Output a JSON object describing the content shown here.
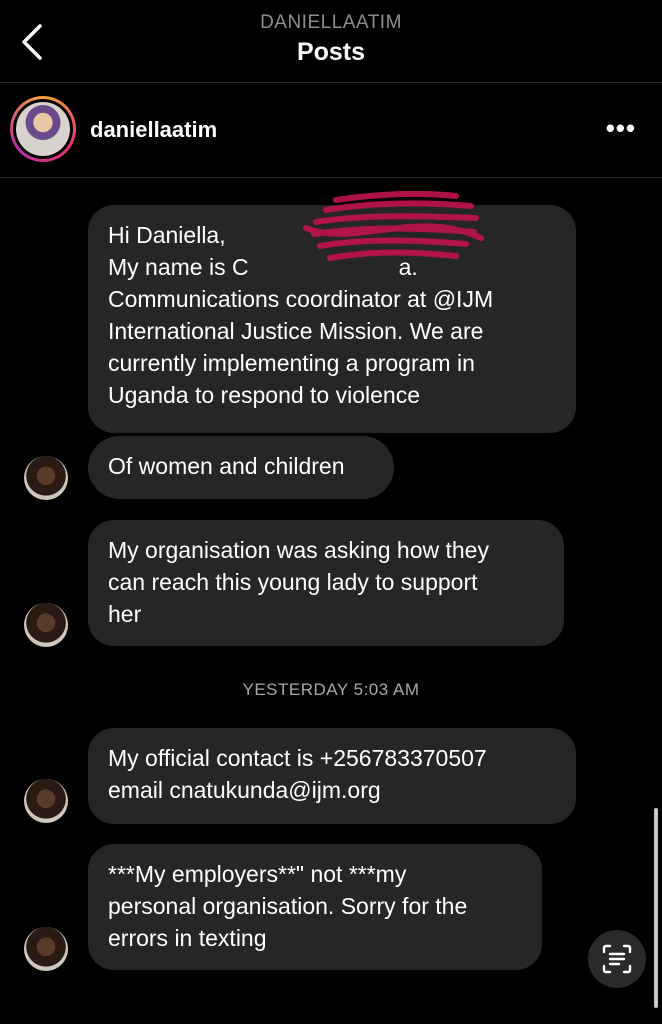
{
  "header": {
    "username": "DANIELLAATIM",
    "title": "Posts",
    "back_icon": "chevron-left-icon"
  },
  "profile": {
    "username": "daniellaatim",
    "more_icon": "more-horizontal-icon",
    "more_glyph": "•••"
  },
  "messages": [
    {
      "lines": [
        "Hi Daniella,",
        "My name is C",
        "Communications coordinator at  @IJM",
        "International Justice Mission. We are",
        "currently implementing a program in",
        "Uganda to respond to  violence"
      ]
    },
    {
      "lines": [
        "Of women and children"
      ]
    },
    {
      "lines": [
        "My organisation was asking how they",
        "can reach this young lady to support",
        "her"
      ]
    },
    {
      "lines": [
        "My official contact is +256783370507",
        "email cnatukunda@ijm.org"
      ]
    },
    {
      "lines": [
        "***My employers**\" not ***my",
        "personal organisation. Sorry for the",
        "errors in texting"
      ]
    }
  ],
  "timestamp": "YESTERDAY 5:03 AM",
  "scan_icon": "text-scan-icon",
  "colors": {
    "background": "#000000",
    "bubble": "#262626",
    "muted": "#8e8e8e",
    "redaction": "#c0134f"
  }
}
